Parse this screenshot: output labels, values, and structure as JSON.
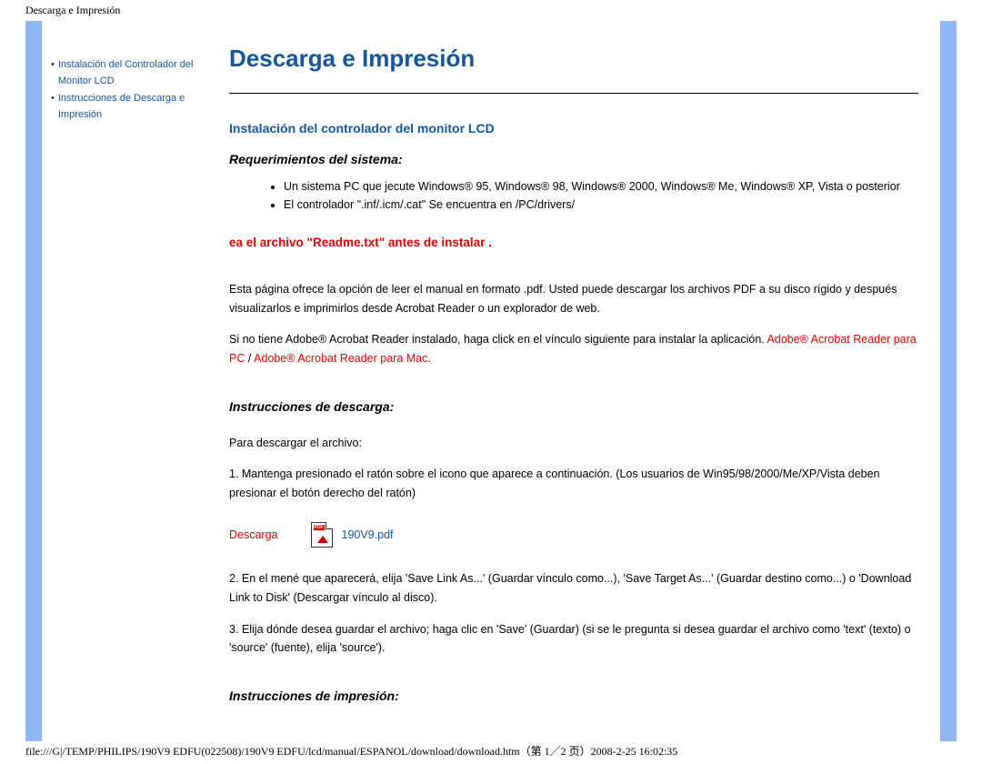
{
  "header": {
    "doc_title": "Descarga e Impresión"
  },
  "sidebar": {
    "items": [
      {
        "label": "Instalación del Controlador del Monitor LCD"
      },
      {
        "label": "Instrucciones de Descarga e Impresión"
      }
    ]
  },
  "main": {
    "title": "Descarga e Impresión",
    "h2a": "Instalación del controlador del monitor LCD",
    "req_heading": "Requerimientos del sistema:",
    "req_items": [
      "Un sistema PC que jecute Windows® 95, Windows® 98, Windows® 2000, Windows® Me, Windows® XP, Vista o posterior",
      "El controlador \".inf/.icm/.cat\" Se encuentra en /PC/drivers/"
    ],
    "readme_warning": "ea el archivo \"Readme.txt\" antes de instalar .",
    "intro_para": "Esta página ofrece la opción de leer el manual en formato .pdf. Usted puede descargar los archivos PDF a su disco rígido y después visualizarlos e imprimirlos desde Acrobat Reader o un explorador de web.",
    "acrobat_para_prefix": "Si no tiene Adobe® Acrobat Reader instalado, haga click en el vínculo siguiente para instalar la aplicación. ",
    "link_pc": "Adobe® Acrobat Reader para PC",
    "link_sep": " / ",
    "link_mac": "Adobe® Acrobat Reader para Mac",
    "link_suffix": ".",
    "download_heading": "Instrucciones de descarga:",
    "download_intro": "Para descargar el archivo:",
    "step1": "1. Mantenga presionado el ratón sobre el icono que aparece a continuación. (Los usuarios de Win95/98/2000/Me/XP/Vista deben presionar el botón derecho del ratón)",
    "download_label": "Descarga",
    "pdf_name": "190V9.pdf",
    "step2": "2. En el mené que aparecerá, elija 'Save Link As...' (Guardar vínculo como...), 'Save Target As...' (Guardar destino como...) o 'Download Link to Disk' (Descargar vínculo al disco).",
    "step3": "3. Elija dónde desea guardar el archivo; haga clic en 'Save' (Guardar) (si se le pregunta si desea guardar el archivo como 'text' (texto) o 'source' (fuente), elija 'source').",
    "print_heading": "Instrucciones de impresión:"
  },
  "footer": {
    "path": "file:///G|/TEMP/PHILIPS/190V9 EDFU(022508)/190V9 EDFU/lcd/manual/ESPANOL/download/download.htm（第 1／2 页）2008-2-25 16:02:35"
  }
}
